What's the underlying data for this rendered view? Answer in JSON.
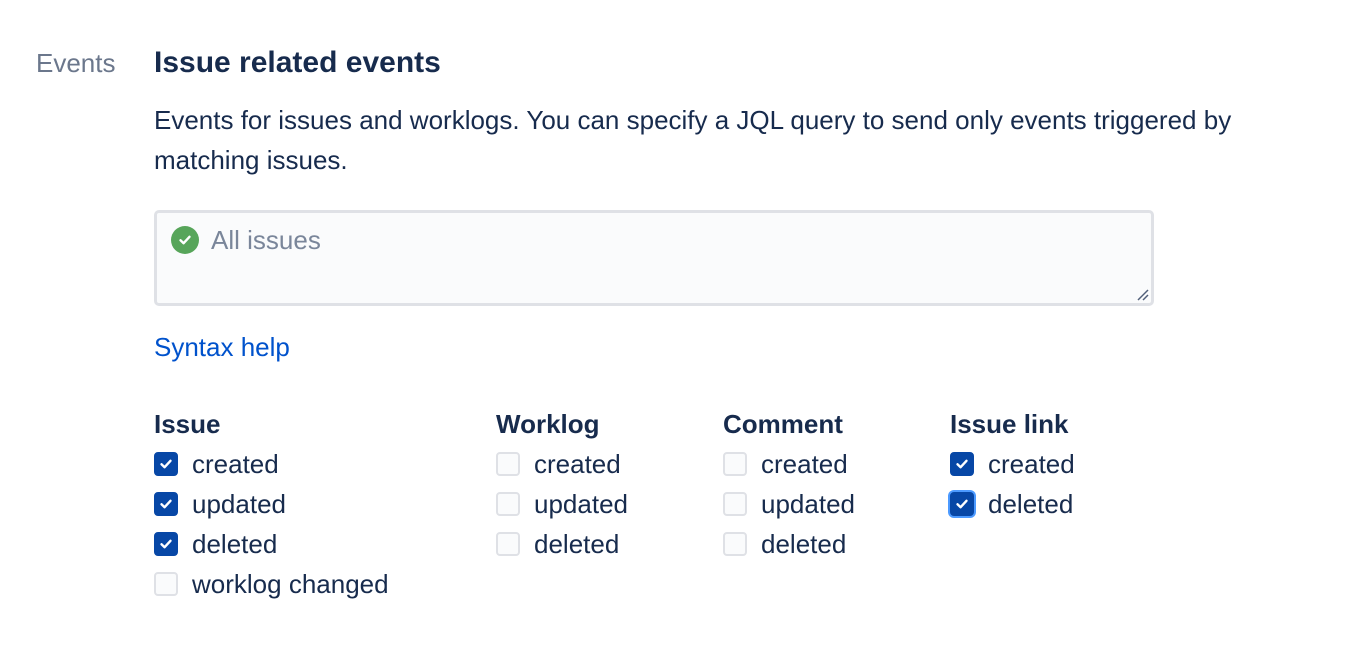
{
  "section": {
    "label": "Events"
  },
  "issue_events": {
    "title": "Issue related events",
    "description": "Events for issues and worklogs. You can specify a JQL query to send only events triggered by matching issues.",
    "jql": {
      "value": "All issues",
      "status": "valid"
    },
    "syntax_help_label": "Syntax help"
  },
  "groups": [
    {
      "title": "Issue",
      "options": [
        {
          "label": "created",
          "checked": true
        },
        {
          "label": "updated",
          "checked": true
        },
        {
          "label": "deleted",
          "checked": true
        },
        {
          "label": "worklog changed",
          "checked": false
        }
      ]
    },
    {
      "title": "Worklog",
      "options": [
        {
          "label": "created",
          "checked": false
        },
        {
          "label": "updated",
          "checked": false
        },
        {
          "label": "deleted",
          "checked": false
        }
      ]
    },
    {
      "title": "Comment",
      "options": [
        {
          "label": "created",
          "checked": false
        },
        {
          "label": "updated",
          "checked": false
        },
        {
          "label": "deleted",
          "checked": false
        }
      ]
    },
    {
      "title": "Issue link",
      "options": [
        {
          "label": "created",
          "checked": true
        },
        {
          "label": "deleted",
          "checked": true,
          "focused": true
        }
      ]
    }
  ],
  "colors": {
    "checked": "#0747a6",
    "link": "#0052cc",
    "valid": "#57a55a",
    "focus_ring": "#4c9aff"
  }
}
